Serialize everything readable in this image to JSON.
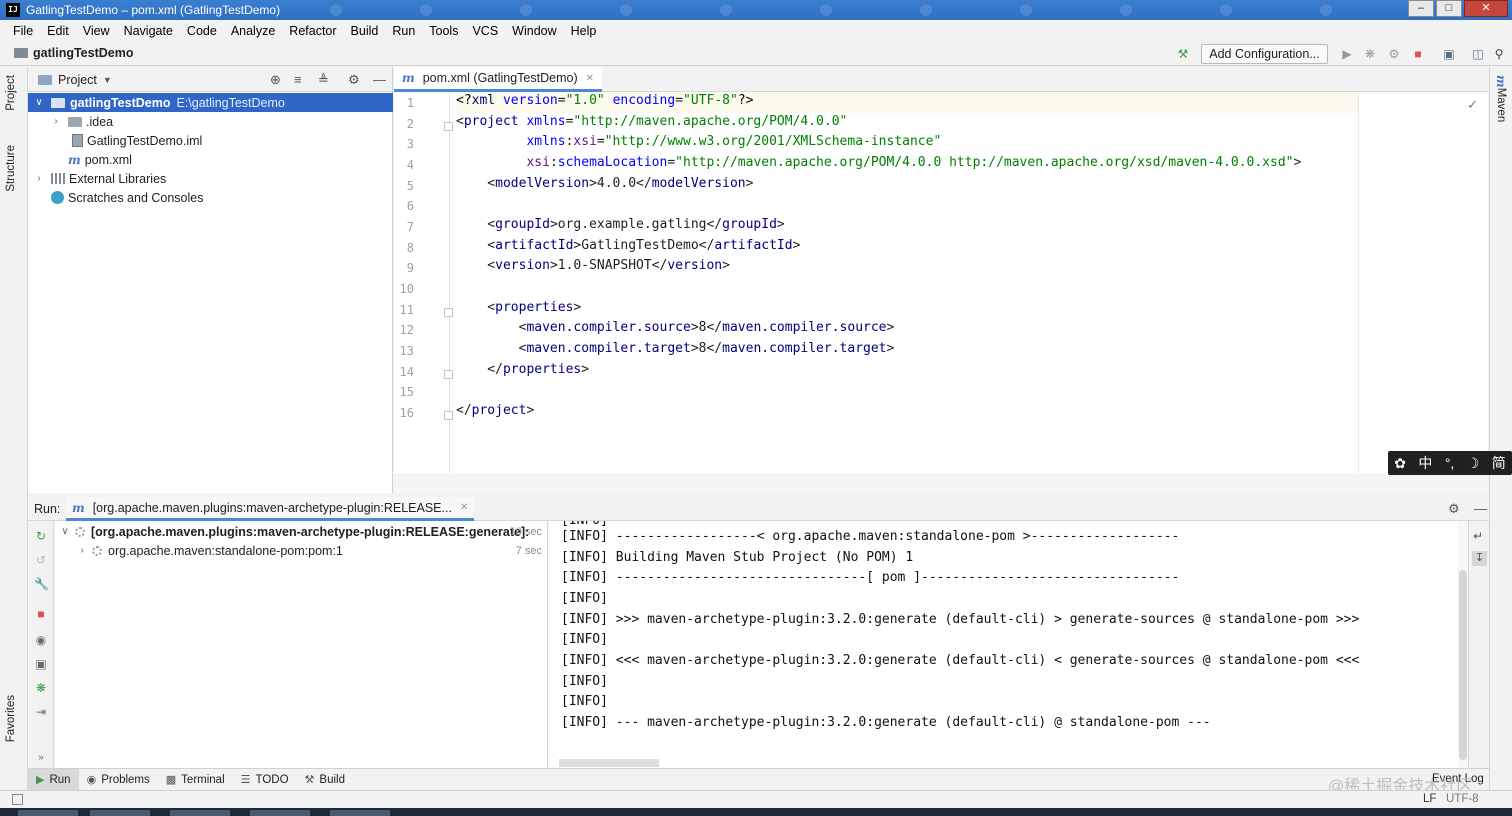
{
  "window": {
    "title": "GatlingTestDemo – pom.xml (GatlingTestDemo)",
    "app_icon": "IJ"
  },
  "menu": [
    "File",
    "Edit",
    "View",
    "Navigate",
    "Code",
    "Analyze",
    "Refactor",
    "Build",
    "Run",
    "Tools",
    "VCS",
    "Window",
    "Help"
  ],
  "navbar": {
    "project": "gatlingTestDemo",
    "add_configuration": "Add Configuration..."
  },
  "left_strip": {
    "project_tab": "Project",
    "structure_tab": "Structure",
    "favorites_tab": "Favorites"
  },
  "right_strip": {
    "maven_tab": "Maven"
  },
  "project_panel": {
    "title": "Project",
    "tree": [
      {
        "label": "gatlingTestDemo",
        "path": "E:\\gatlingTestDemo"
      },
      {
        "label": ".idea"
      },
      {
        "label": "GatlingTestDemo.iml"
      },
      {
        "label": "pom.xml"
      },
      {
        "label": "External Libraries"
      },
      {
        "label": "Scratches and Consoles"
      }
    ]
  },
  "editor": {
    "tab": "pom.xml (GatlingTestDemo)",
    "line_numbers": [
      "1",
      "2",
      "3",
      "4",
      "5",
      "6",
      "7",
      "8",
      "9",
      "10",
      "11",
      "12",
      "13",
      "14",
      "15",
      "16"
    ]
  },
  "ime": {
    "items": [
      "中",
      "°,",
      "简"
    ]
  },
  "run_panel": {
    "label": "Run:",
    "tab": "[org.apache.maven.plugins:maven-archetype-plugin:RELEASE...",
    "tree": [
      {
        "label": "[org.apache.maven.plugins:maven-archetype-plugin:RELEASE:generate]:",
        "time": "10 sec"
      },
      {
        "label": "org.apache.maven:standalone-pom:pom:1",
        "time": "7 sec"
      }
    ],
    "console": [
      "[INFO] ------------------< org.apache.maven:standalone-pom >-------------------",
      "[INFO] Building Maven Stub Project (No POM) 1",
      "[INFO] --------------------------------[ pom ]---------------------------------",
      "[INFO]",
      "[INFO] >>> maven-archetype-plugin:3.2.0:generate (default-cli) > generate-sources @ standalone-pom >>>",
      "[INFO]",
      "[INFO] <<< maven-archetype-plugin:3.2.0:generate (default-cli) < generate-sources @ standalone-pom <<<",
      "[INFO]",
      "[INFO]",
      "[INFO] --- maven-archetype-plugin:3.2.0:generate (default-cli) @ standalone-pom ---"
    ]
  },
  "bottom_tabs": [
    "Run",
    "Problems",
    "Terminal",
    "TODO",
    "Build"
  ],
  "event_log": "Event Log",
  "status": {
    "line_sep": "LF",
    "encoding": "UTF-8"
  },
  "watermark": "@稀土掘金技术社区",
  "colors": {
    "selection": "#2f66c8",
    "tag": "#000080",
    "attr": "#0000ff",
    "value": "#008000"
  }
}
